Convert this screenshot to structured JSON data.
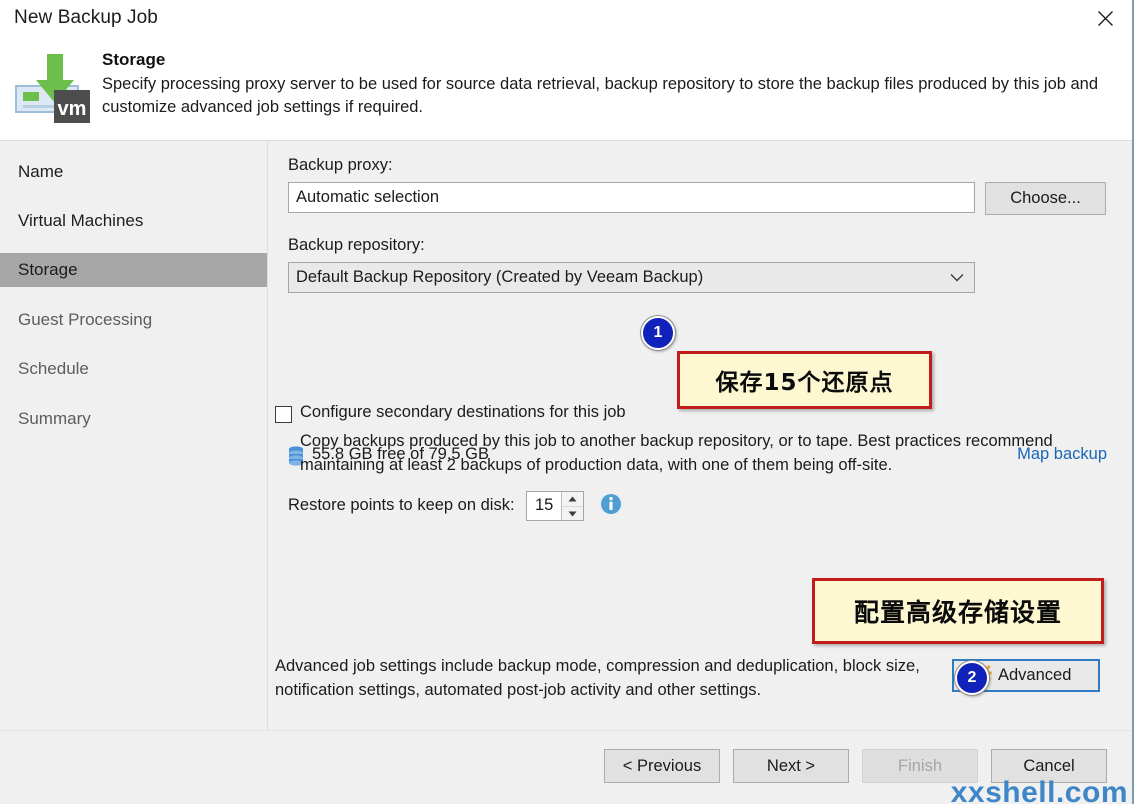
{
  "window": {
    "title": "New Backup Job",
    "close_icon": "close-icon"
  },
  "header": {
    "icon": "backup-vm-icon",
    "title": "Storage",
    "description": "Specify processing proxy server to be used for source data retrieval, backup repository to store the backup files produced by this job and customize advanced job settings if required."
  },
  "sidebar": {
    "items": [
      {
        "label": "Name",
        "state": "done"
      },
      {
        "label": "Virtual Machines",
        "state": "done"
      },
      {
        "label": "Storage",
        "state": "active"
      },
      {
        "label": "Guest Processing",
        "state": "pending"
      },
      {
        "label": "Schedule",
        "state": "pending"
      },
      {
        "label": "Summary",
        "state": "pending"
      }
    ]
  },
  "form": {
    "proxy_label": "Backup proxy:",
    "proxy_value": "Automatic selection",
    "choose_button": "Choose...",
    "repository_label": "Backup repository:",
    "repository_value": "Default Backup Repository (Created by Veeam Backup)",
    "repository_icon": "database-stack-icon",
    "free_space": "55.8 GB free of 79.5 GB",
    "map_backup_link": "Map backup",
    "restore_points_label": "Restore points to keep on disk:",
    "restore_points_value": "15",
    "info_icon": "info-icon",
    "spinner_up_icon": "spinner-up-icon",
    "spinner_down_icon": "spinner-down-icon",
    "secondary_checkbox_label": "Configure secondary destinations for this job",
    "secondary_checkbox_checked": false,
    "secondary_description": "Copy backups produced by this job to another backup repository, or to tape. Best practices recommend maintaining at least 2 backups of production data, with one of them being off-site.",
    "advanced_description": "Advanced job settings include backup mode, compression and deduplication, block size, notification settings, automated post-job activity and other settings.",
    "advanced_button": "Advanced",
    "advanced_gear_icon": "gear-icon"
  },
  "footer": {
    "previous": "< Previous",
    "next": "Next >",
    "finish": "Finish",
    "finish_disabled": true,
    "cancel": "Cancel"
  },
  "annotations": {
    "badge_1": "1",
    "badge_2": "2",
    "callout_1": "保存15个还原点",
    "callout_2": "配置高级存储设置",
    "watermark": "xxshell.com"
  },
  "colors": {
    "accent_link": "#1866b8",
    "active_nav": "#a6a6a6",
    "callout_border": "#c21d1d",
    "callout_fill": "#fdf8d2",
    "badge_fill": "#1122bb",
    "focus_border": "#2f7cc4",
    "watermark": "#2f7ec4"
  }
}
